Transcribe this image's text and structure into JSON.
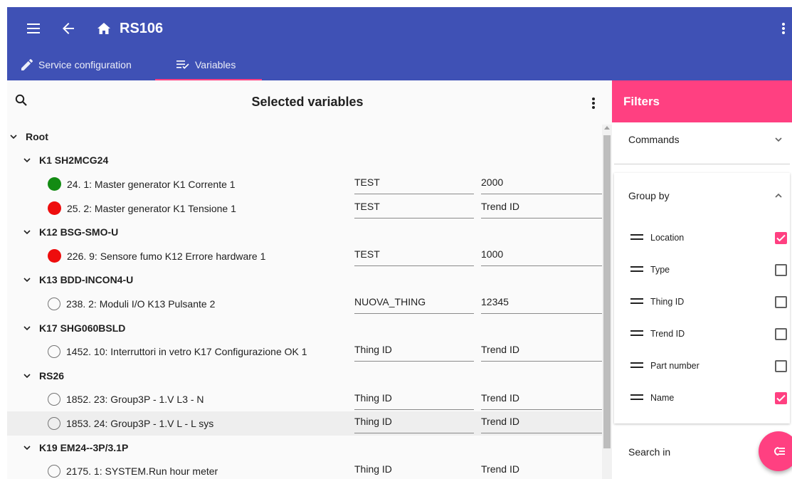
{
  "app": {
    "title": "RS106"
  },
  "tabs": [
    {
      "label": "Service configuration",
      "icon": "pencil-icon",
      "active": false
    },
    {
      "label": "Variables",
      "icon": "list-check-icon",
      "active": true
    }
  ],
  "main": {
    "title": "Selected variables",
    "root_label": "Root",
    "groups": [
      {
        "label": "K1 SH2MCG24",
        "items": [
          {
            "label": "24. 1: Master generator K1 Corrente 1",
            "status": "green",
            "thing": "TEST",
            "trend": "2000"
          },
          {
            "label": "25. 2: Master generator K1 Tensione 1",
            "status": "red",
            "thing": "TEST",
            "trend": "Trend ID"
          }
        ]
      },
      {
        "label": "K12 BSG-SMO-U",
        "items": [
          {
            "label": "226. 9: Sensore fumo K12 Errore hardware 1",
            "status": "red",
            "thing": "TEST",
            "trend": "1000"
          }
        ]
      },
      {
        "label": "K13 BDD-INCON4-U",
        "items": [
          {
            "label": "238. 2: Moduli I/O K13 Pulsante 2",
            "status": "empty",
            "thing": "NUOVA_THING",
            "trend": "12345"
          }
        ]
      },
      {
        "label": "K17 SHG060BSLD",
        "items": [
          {
            "label": "1452. 10: Interruttori in vetro K17 Configurazione OK 1",
            "status": "empty",
            "thing": "Thing ID",
            "trend": "Trend ID"
          }
        ]
      },
      {
        "label": "RS26",
        "items": [
          {
            "label": "1852. 23: Group3P - 1.V L3 - N",
            "status": "empty",
            "thing": "Thing ID",
            "trend": "Trend ID"
          },
          {
            "label": "1853. 24: Group3P - 1.V L - L sys",
            "status": "empty",
            "thing": "Thing ID",
            "trend": "Trend ID",
            "highlight": true
          }
        ]
      },
      {
        "label": "K19 EM24--3P/3.1P",
        "items": [
          {
            "label": "2175. 1: SYSTEM.Run hour meter",
            "status": "empty",
            "thing": "Thing ID",
            "trend": "Trend ID"
          }
        ]
      }
    ]
  },
  "filters": {
    "title": "Filters",
    "commands_label": "Commands",
    "group_by_label": "Group by",
    "group_by_items": [
      {
        "label": "Location",
        "checked": true
      },
      {
        "label": "Type",
        "checked": false
      },
      {
        "label": "Thing ID",
        "checked": false
      },
      {
        "label": "Trend ID",
        "checked": false
      },
      {
        "label": "Part number",
        "checked": false
      },
      {
        "label": "Name",
        "checked": true
      }
    ],
    "search_in_label": "Search in"
  },
  "colors": {
    "primary": "#3f51b5",
    "accent": "#ff4081",
    "status_green": "#138b13",
    "status_red": "#ee0d0d"
  }
}
